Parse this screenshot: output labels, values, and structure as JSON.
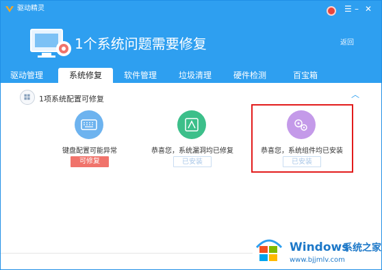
{
  "app": {
    "title": "驱动精灵"
  },
  "header": {
    "headline": "1个系统问题需要修复",
    "back_label": "返回"
  },
  "tabs": [
    {
      "label": "驱动管理",
      "active": false
    },
    {
      "label": "系统修复",
      "active": true
    },
    {
      "label": "软件管理",
      "active": false
    },
    {
      "label": "垃圾清理",
      "active": false
    },
    {
      "label": "硬件检测",
      "active": false
    },
    {
      "label": "百宝箱",
      "active": false
    }
  ],
  "section": {
    "label_pre": "1项系统",
    "label_emph": "配置",
    "label_post": "可修复"
  },
  "items": [
    {
      "label": "键盘配置可能异常",
      "button": "可修复",
      "status": "fixable",
      "icon": "keyboard-icon",
      "color": "#6db3ef"
    },
    {
      "label": "恭喜您，系统漏洞均已修复",
      "button": "已安装",
      "status": "done",
      "icon": "shield-icon",
      "color": "#3cbf8a"
    },
    {
      "label": "恭喜您，系统组件均已安装",
      "button": "已安装",
      "status": "done",
      "icon": "gears-icon",
      "color": "#c49ae9"
    }
  ],
  "watermark": {
    "title": "Windows",
    "subtitle": "系统之家",
    "url": "www.bjjmlv.com"
  },
  "colors": {
    "header": "#2e9ff0",
    "highlight": "#e21a1a",
    "fix_button": "#f0736b"
  }
}
